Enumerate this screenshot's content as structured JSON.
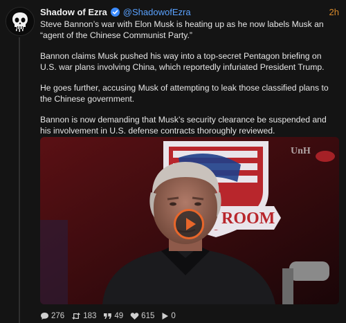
{
  "post": {
    "author": {
      "display_name": "Shadow of Ezra",
      "handle": "@ShadowofEzra",
      "verified": true,
      "avatar_icon": "skull-avatar-icon"
    },
    "time": "2h",
    "paragraphs": [
      "Steve Bannon’s war with Elon Musk is heating up as he now labels Musk an “agent of the Chinese Communist Party.”",
      "Bannon claims Musk pushed his way into a top-secret Pentagon briefing on U.S. war plans involving China, which reportedly infuriated President Trump.",
      "He goes further, accusing Musk of attempting to leak those classified plans to the Chinese government.",
      "Bannon is now demanding that Musk’s security clearance be suspended and his involvement in U.S. defense contracts thoroughly reviewed."
    ],
    "media": {
      "type": "video",
      "overlay_texts": [
        "UnH",
        "ROOM"
      ]
    },
    "actions": {
      "replies": "276",
      "reposts": "183",
      "quotes": "49",
      "likes": "615",
      "views": "0"
    }
  },
  "colors": {
    "accent": "#e8662a",
    "handle": "#5aa2ff",
    "time": "#d98a2b",
    "background": "#141414"
  }
}
